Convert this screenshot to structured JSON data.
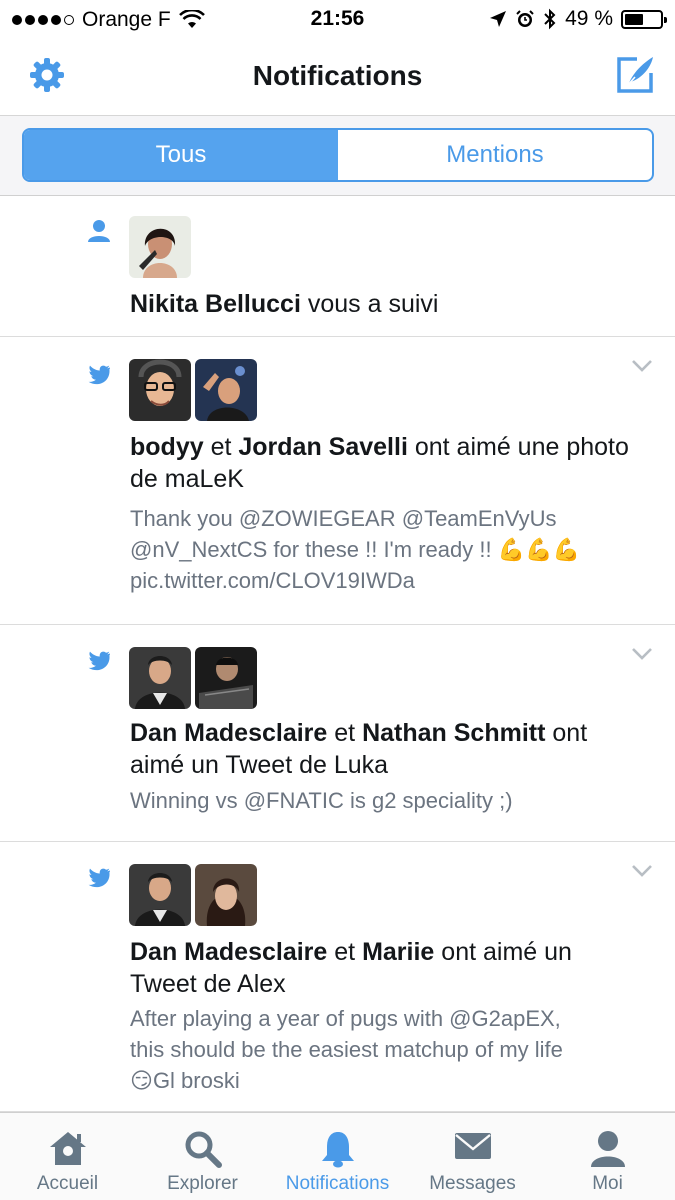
{
  "status_bar": {
    "carrier": "Orange F",
    "time": "21:56",
    "battery": "49 %"
  },
  "nav": {
    "title": "Notifications",
    "settings_icon": "gear-icon",
    "compose_icon": "compose-icon"
  },
  "segments": {
    "tous": "Tous",
    "mentions": "Mentions",
    "selected": "Tous"
  },
  "notifications": [
    {
      "type": "follow",
      "icon": "person-icon",
      "name1": "Nikita Bellucci",
      "action": " vous a suivi"
    },
    {
      "type": "like",
      "icon": "twitter-bird-icon",
      "name1": "bodyy",
      "connector": " et ",
      "name2": "Jordan Savelli",
      "action": " ont aimé une photo de maLeK",
      "snippet_line1": "Thank you @ZOWIEGEAR @TeamEnVyUs",
      "snippet_line2": "@nV_NextCS for these !! I'm ready !!",
      "snippet_emoji": "💪💪💪",
      "snippet_line3": "pic.twitter.com/CLOV19IWDa"
    },
    {
      "type": "like",
      "icon": "twitter-bird-icon",
      "name1": "Dan Madesclaire",
      "connector": " et ",
      "name2": "Nathan Schmitt",
      "action": " ont aimé un Tweet de Luka",
      "snippet_line1": "Winning vs @FNATIC is g2 speciality ;)"
    },
    {
      "type": "like",
      "icon": "twitter-bird-icon",
      "name1": "Dan Madesclaire",
      "connector": " et ",
      "name2": "Mariie",
      "action": " ont aimé un Tweet de Alex",
      "snippet_line1": "After playing a year of pugs with @G2apEX,",
      "snippet_line2": "this should be the easiest matchup of my life",
      "snippet_emoji": "😏",
      "snippet_line3": "Gl broski"
    }
  ],
  "tab_bar": {
    "home": "Accueil",
    "explore": "Explorer",
    "notifications": "Notifications",
    "messages": "Messages",
    "me": "Moi",
    "active": "Notifications"
  },
  "colors": {
    "accent": "#4a9ae8",
    "text": "#14171a",
    "secondary": "#6b7480",
    "tab_inactive": "#657786"
  }
}
